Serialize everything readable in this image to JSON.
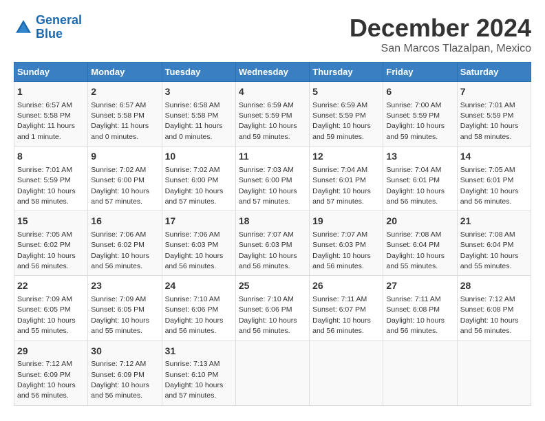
{
  "logo": {
    "line1": "General",
    "line2": "Blue"
  },
  "header": {
    "month": "December 2024",
    "location": "San Marcos Tlazalpan, Mexico"
  },
  "days_of_week": [
    "Sunday",
    "Monday",
    "Tuesday",
    "Wednesday",
    "Thursday",
    "Friday",
    "Saturday"
  ],
  "weeks": [
    [
      {
        "num": "1",
        "sunrise": "6:57 AM",
        "sunset": "5:58 PM",
        "daylight": "11 hours and 1 minute."
      },
      {
        "num": "2",
        "sunrise": "6:57 AM",
        "sunset": "5:58 PM",
        "daylight": "11 hours and 0 minutes."
      },
      {
        "num": "3",
        "sunrise": "6:58 AM",
        "sunset": "5:58 PM",
        "daylight": "11 hours and 0 minutes."
      },
      {
        "num": "4",
        "sunrise": "6:59 AM",
        "sunset": "5:59 PM",
        "daylight": "10 hours and 59 minutes."
      },
      {
        "num": "5",
        "sunrise": "6:59 AM",
        "sunset": "5:59 PM",
        "daylight": "10 hours and 59 minutes."
      },
      {
        "num": "6",
        "sunrise": "7:00 AM",
        "sunset": "5:59 PM",
        "daylight": "10 hours and 59 minutes."
      },
      {
        "num": "7",
        "sunrise": "7:01 AM",
        "sunset": "5:59 PM",
        "daylight": "10 hours and 58 minutes."
      }
    ],
    [
      {
        "num": "8",
        "sunrise": "7:01 AM",
        "sunset": "5:59 PM",
        "daylight": "10 hours and 58 minutes."
      },
      {
        "num": "9",
        "sunrise": "7:02 AM",
        "sunset": "6:00 PM",
        "daylight": "10 hours and 57 minutes."
      },
      {
        "num": "10",
        "sunrise": "7:02 AM",
        "sunset": "6:00 PM",
        "daylight": "10 hours and 57 minutes."
      },
      {
        "num": "11",
        "sunrise": "7:03 AM",
        "sunset": "6:00 PM",
        "daylight": "10 hours and 57 minutes."
      },
      {
        "num": "12",
        "sunrise": "7:04 AM",
        "sunset": "6:01 PM",
        "daylight": "10 hours and 57 minutes."
      },
      {
        "num": "13",
        "sunrise": "7:04 AM",
        "sunset": "6:01 PM",
        "daylight": "10 hours and 56 minutes."
      },
      {
        "num": "14",
        "sunrise": "7:05 AM",
        "sunset": "6:01 PM",
        "daylight": "10 hours and 56 minutes."
      }
    ],
    [
      {
        "num": "15",
        "sunrise": "7:05 AM",
        "sunset": "6:02 PM",
        "daylight": "10 hours and 56 minutes."
      },
      {
        "num": "16",
        "sunrise": "7:06 AM",
        "sunset": "6:02 PM",
        "daylight": "10 hours and 56 minutes."
      },
      {
        "num": "17",
        "sunrise": "7:06 AM",
        "sunset": "6:03 PM",
        "daylight": "10 hours and 56 minutes."
      },
      {
        "num": "18",
        "sunrise": "7:07 AM",
        "sunset": "6:03 PM",
        "daylight": "10 hours and 56 minutes."
      },
      {
        "num": "19",
        "sunrise": "7:07 AM",
        "sunset": "6:03 PM",
        "daylight": "10 hours and 56 minutes."
      },
      {
        "num": "20",
        "sunrise": "7:08 AM",
        "sunset": "6:04 PM",
        "daylight": "10 hours and 55 minutes."
      },
      {
        "num": "21",
        "sunrise": "7:08 AM",
        "sunset": "6:04 PM",
        "daylight": "10 hours and 55 minutes."
      }
    ],
    [
      {
        "num": "22",
        "sunrise": "7:09 AM",
        "sunset": "6:05 PM",
        "daylight": "10 hours and 55 minutes."
      },
      {
        "num": "23",
        "sunrise": "7:09 AM",
        "sunset": "6:05 PM",
        "daylight": "10 hours and 55 minutes."
      },
      {
        "num": "24",
        "sunrise": "7:10 AM",
        "sunset": "6:06 PM",
        "daylight": "10 hours and 56 minutes."
      },
      {
        "num": "25",
        "sunrise": "7:10 AM",
        "sunset": "6:06 PM",
        "daylight": "10 hours and 56 minutes."
      },
      {
        "num": "26",
        "sunrise": "7:11 AM",
        "sunset": "6:07 PM",
        "daylight": "10 hours and 56 minutes."
      },
      {
        "num": "27",
        "sunrise": "7:11 AM",
        "sunset": "6:08 PM",
        "daylight": "10 hours and 56 minutes."
      },
      {
        "num": "28",
        "sunrise": "7:12 AM",
        "sunset": "6:08 PM",
        "daylight": "10 hours and 56 minutes."
      }
    ],
    [
      {
        "num": "29",
        "sunrise": "7:12 AM",
        "sunset": "6:09 PM",
        "daylight": "10 hours and 56 minutes."
      },
      {
        "num": "30",
        "sunrise": "7:12 AM",
        "sunset": "6:09 PM",
        "daylight": "10 hours and 56 minutes."
      },
      {
        "num": "31",
        "sunrise": "7:13 AM",
        "sunset": "6:10 PM",
        "daylight": "10 hours and 57 minutes."
      },
      null,
      null,
      null,
      null
    ]
  ],
  "labels": {
    "sunrise": "Sunrise:",
    "sunset": "Sunset:",
    "daylight": "Daylight:"
  }
}
